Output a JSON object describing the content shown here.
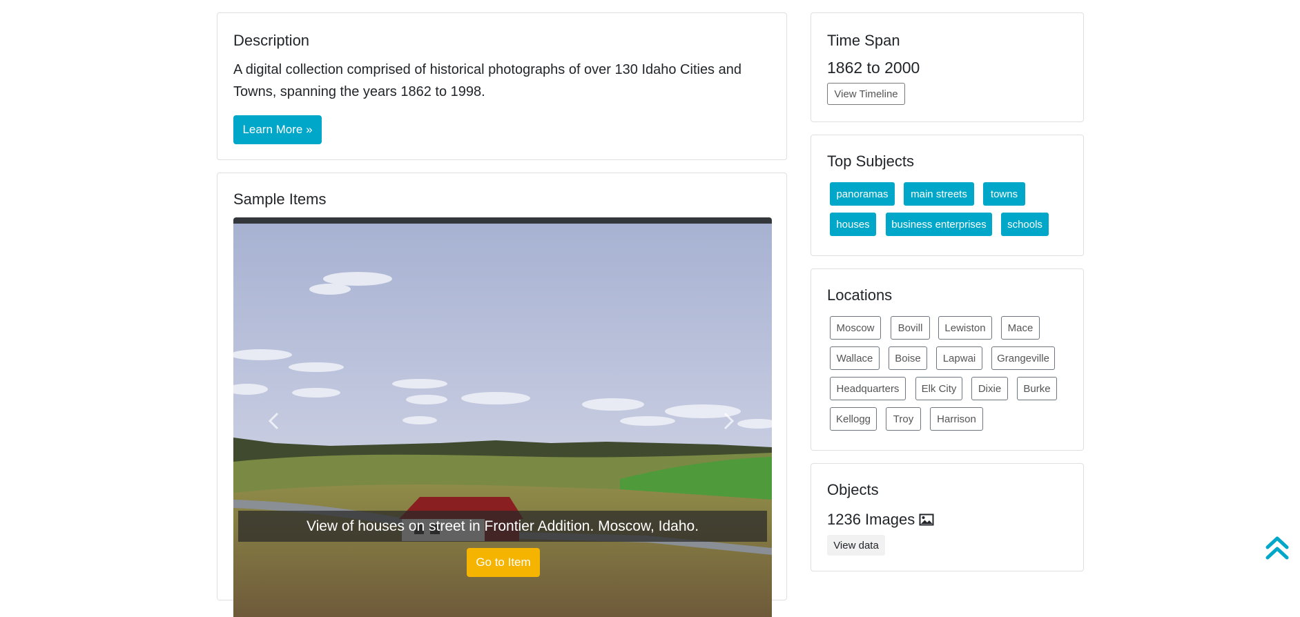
{
  "description": {
    "title": "Description",
    "text": "A digital collection comprised of historical photographs of over 130 Idaho Cities and Towns, spanning the years 1862 to 1998.",
    "learn_more_label": "Learn More »"
  },
  "sample_items": {
    "title": "Sample Items",
    "caption": "View of houses on street in Frontier Addition. Moscow, Idaho.",
    "go_label": "Go to Item",
    "prev_icon": "chevron-left-icon",
    "next_icon": "chevron-right-icon"
  },
  "time_span": {
    "title": "Time Span",
    "value": "1862 to 2000",
    "button_label": "View Timeline"
  },
  "top_subjects": {
    "title": "Top Subjects",
    "items": [
      "panoramas",
      "main streets",
      "towns",
      "houses",
      "business enterprises",
      "schools"
    ]
  },
  "locations": {
    "title": "Locations",
    "items": [
      "Moscow",
      "Bovill",
      "Lewiston",
      "Mace",
      "Wallace",
      "Boise",
      "Lapwai",
      "Grangeville",
      "Headquarters",
      "Elk City",
      "Dixie",
      "Burke",
      "Kellogg",
      "Troy",
      "Harrison"
    ]
  },
  "objects": {
    "title": "Objects",
    "count_text": "1236 Images",
    "count_icon": "image-icon",
    "button_label": "View data"
  },
  "scroll_top_icon": "double-chevron-up-icon",
  "colors": {
    "accent": "#00a7c8",
    "go_button": "#f5b400",
    "carousel_bar": "#33373b"
  }
}
